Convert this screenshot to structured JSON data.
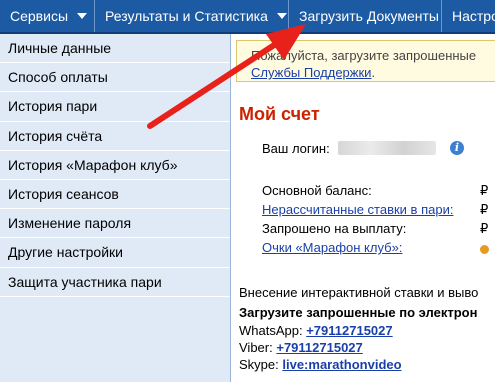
{
  "topnav": {
    "tabs": [
      {
        "label": "Сервисы",
        "dropdown": true
      },
      {
        "label": "Результаты и Статистика",
        "dropdown": true
      },
      {
        "label": "Загрузить Документы",
        "dropdown": false
      },
      {
        "label": "Настро",
        "dropdown": false
      }
    ]
  },
  "sidebar": {
    "items": [
      {
        "label": "Личные данные"
      },
      {
        "label": "Способ оплаты"
      },
      {
        "label": "История пари"
      },
      {
        "label": "История счёта"
      },
      {
        "label": "История «Марафон клуб»"
      },
      {
        "label": "История сеансов"
      },
      {
        "label": "Изменение пароля"
      },
      {
        "label": "Другие настройки"
      },
      {
        "label": "Защита участника пари"
      }
    ]
  },
  "notice": {
    "line1": "Пожалуйста, загрузите запрошенные",
    "link": "Службы Поддержки",
    "line2_suffix": "."
  },
  "account": {
    "title": "Мой счет",
    "login_label": "Ваш логин:",
    "balance_label": "Основной баланс:",
    "balance_value": "₽",
    "unsettled_label": "Нерассчитанные ставки в пари:",
    "unsettled_value": "₽",
    "payout_label": "Запрошено на выплату:",
    "payout_value": "₽",
    "club_points_label": "Очки «Марафон клуб»:"
  },
  "upload_section": {
    "intro": "Внесение интерактивной ставки и выво",
    "heading": "Загрузите запрошенные по электрон",
    "contacts": [
      {
        "label": "WhatsApp:",
        "value": "+79112715027"
      },
      {
        "label": "Viber:",
        "value": "+79112715027"
      },
      {
        "label": "Skype:",
        "value": "live:marathonvideo"
      }
    ]
  },
  "colors": {
    "topbar": "#1c5ba4",
    "sidebar": "#dfeaf6",
    "title_red": "#cc2200",
    "link_blue": "#1a3fa8",
    "arrow_red": "#e8211b"
  }
}
